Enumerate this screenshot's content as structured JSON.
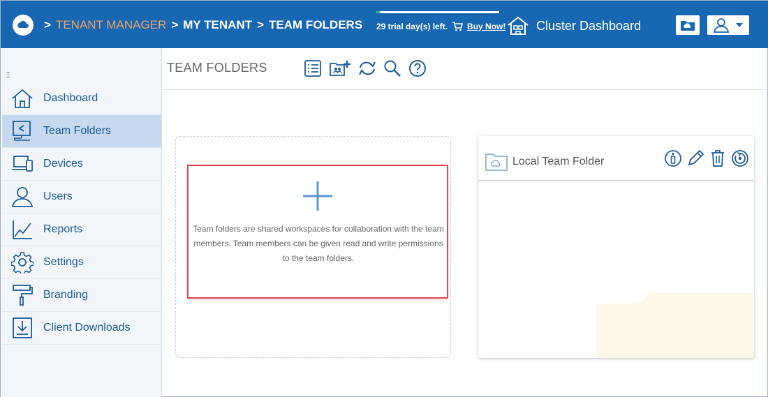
{
  "header": {
    "breadcrumb": {
      "sep1": ">",
      "item1": "TENANT MANAGER",
      "sep2": ">",
      "item2": "MY TENANT",
      "sep3": ">",
      "item3": "TEAM FOLDERS"
    },
    "trial_text": "29 trial day(s) left.",
    "buy_label": "Buy Now!",
    "cluster_label": "Cluster Dashboard",
    "trial_progress": 0.03
  },
  "sidebar": {
    "collapse_glyph": "⌶",
    "items": [
      {
        "label": "Dashboard",
        "icon": "home-icon"
      },
      {
        "label": "Team Folders",
        "icon": "team-folder-icon",
        "active": true
      },
      {
        "label": "Devices",
        "icon": "devices-icon"
      },
      {
        "label": "Users",
        "icon": "users-icon"
      },
      {
        "label": "Reports",
        "icon": "reports-icon"
      },
      {
        "label": "Settings",
        "icon": "gear-icon"
      },
      {
        "label": "Branding",
        "icon": "paint-roller-icon"
      },
      {
        "label": "Client Downloads",
        "icon": "download-icon"
      }
    ]
  },
  "main": {
    "title": "TEAM FOLDERS",
    "add_card": {
      "description": "Team folders are shared workspaces for collaboration with the team members. Team members can be given read and write permissions to the team folders."
    },
    "folders": [
      {
        "name": "Local Team Folder"
      }
    ]
  },
  "colors": {
    "header_bg": "#1767b2",
    "accent": "#1c5c9a",
    "breadcrumb_highlight": "#f0a462",
    "highlight_border": "#e0474c"
  }
}
